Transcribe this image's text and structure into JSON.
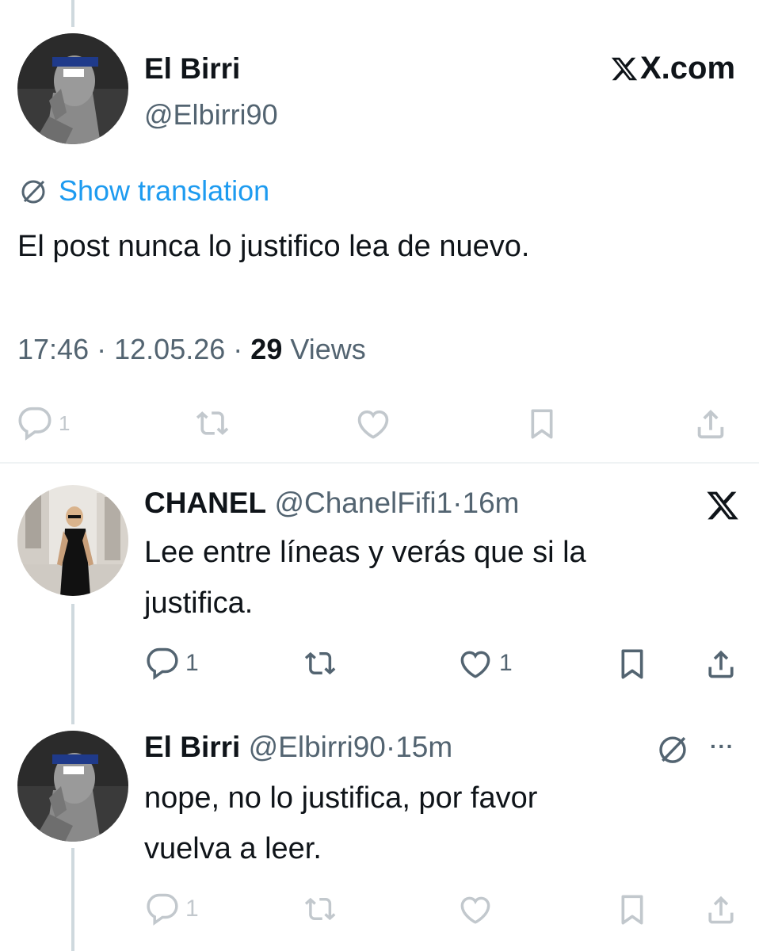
{
  "main_tweet": {
    "author_name": "El Birri",
    "author_handle": "@Elbirri90",
    "brand": "X.com",
    "translation_label": "Show translation",
    "text": "El post nunca lo justifico lea de nuevo.",
    "time": "17:46",
    "date": "12.05.26",
    "views_count": "29",
    "views_label": "Views",
    "sep": "·",
    "actions": {
      "reply_count": "1"
    }
  },
  "replies": [
    {
      "author_name": "CHANEL",
      "author_handle": "@ChanelFifi1",
      "time_ago": "16m",
      "text_line1": "Lee entre líneas y verás que si la",
      "text_line2": "justifica.",
      "actions": {
        "reply_count": "1",
        "like_count": "1"
      }
    },
    {
      "author_name": "El Birri",
      "author_handle": "@Elbirri90",
      "time_ago": "15m",
      "text_line1": "nope, no lo justifica, por favor",
      "text_line2": "vuelva a leer.",
      "more_label": "···",
      "actions": {
        "reply_count": "1"
      }
    }
  ],
  "icons": [
    "translate-icon",
    "x-logo-icon",
    "reply-icon",
    "retweet-icon",
    "like-icon",
    "bookmark-icon",
    "share-icon",
    "more-icon"
  ],
  "colors": {
    "link": "#1d9bf0",
    "muted": "#536471",
    "text": "#0f1419",
    "thread_line": "#cfd9de"
  }
}
